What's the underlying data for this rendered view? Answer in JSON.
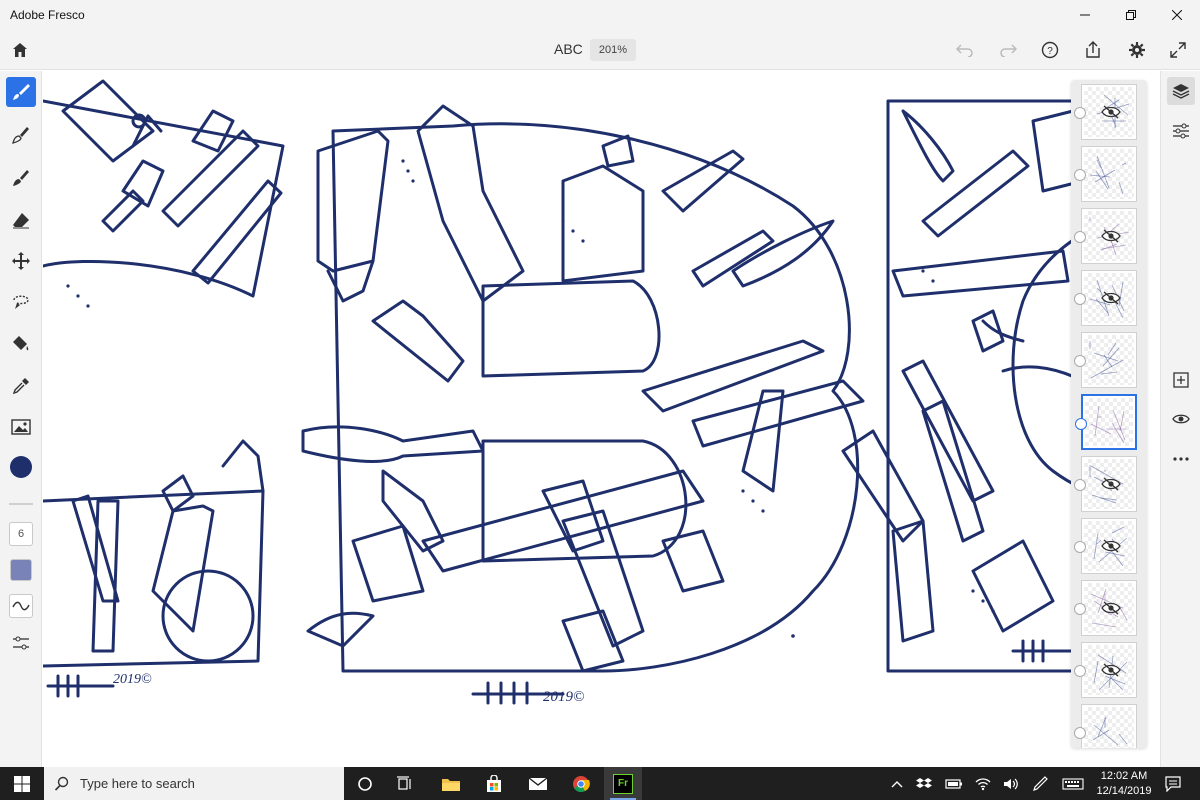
{
  "window": {
    "title": "Adobe Fresco",
    "controls": [
      "minimize",
      "maximize",
      "close"
    ]
  },
  "header": {
    "document_name": "ABC",
    "zoom": "201%",
    "icons": [
      "home-icon",
      "undo-icon",
      "redo-icon",
      "help-icon",
      "share-icon",
      "settings-icon",
      "fullscreen-icon"
    ]
  },
  "left_toolbar": {
    "tools": [
      "pixel-brush",
      "live-brush",
      "vector-brush",
      "eraser",
      "move-transform",
      "selection",
      "fill",
      "eyedropper",
      "place-image"
    ],
    "active_tool": "pixel-brush",
    "brush_color": "#1f2f6b",
    "brush_size": "6"
  },
  "right_toolbar": {
    "icons": [
      "layers-icon",
      "layer-properties-icon",
      "add-layer-icon",
      "visibility-icon",
      "more-icon"
    ]
  },
  "layers": {
    "count": 11,
    "selected_index": 5,
    "hidden_indices": [
      0,
      2,
      3,
      6,
      7,
      8,
      9
    ]
  },
  "taskbar": {
    "search_placeholder": "Type here to search",
    "time": "12:02 AM",
    "date": "12/14/2019",
    "apps": [
      "cortana",
      "task-view",
      "file-explorer",
      "store",
      "mail",
      "chrome",
      "fresco"
    ]
  },
  "colors": {
    "accent": "#2a72e6",
    "ink": "#1f2f6b",
    "chrome_bg": "#f3f3f3",
    "taskbar_bg": "#1f1f1f"
  }
}
